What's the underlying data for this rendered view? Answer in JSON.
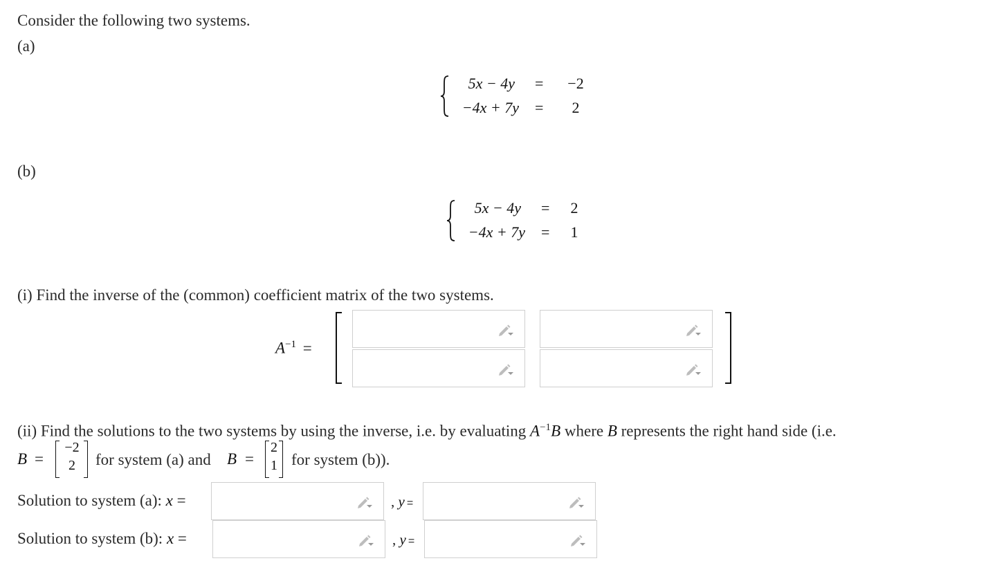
{
  "intro": "Consider the following two systems.",
  "system_a": {
    "label": "(a)",
    "rows": [
      {
        "lhs": "5x − 4y",
        "eq": "=",
        "rhs": "−2"
      },
      {
        "lhs": "−4x + 7y",
        "eq": "=",
        "rhs": "2"
      }
    ]
  },
  "system_b": {
    "label": "(b)",
    "rows": [
      {
        "lhs": "5x − 4y",
        "eq": "=",
        "rhs": "2"
      },
      {
        "lhs": "−4x + 7y",
        "eq": "=",
        "rhs": "1"
      }
    ]
  },
  "part_i": {
    "prompt": "(i) Find the inverse of the (common) coefficient matrix of the two systems.",
    "lhs_label": "A",
    "lhs_sup": "−1",
    "lhs_eq": "=",
    "cells": [
      {
        "value": "",
        "placeholder": ""
      },
      {
        "value": "",
        "placeholder": ""
      },
      {
        "value": "",
        "placeholder": ""
      },
      {
        "value": "",
        "placeholder": ""
      }
    ]
  },
  "part_ii": {
    "prompt_start": "(ii) Find the solutions to the two systems by using the inverse, i.e. by evaluating ",
    "prompt_A": "A",
    "prompt_sup": "−1",
    "prompt_B": "B",
    "prompt_mid": " where ",
    "prompt_B2": "B",
    "prompt_end": " represents the right hand side (i.e.",
    "b_label": "B",
    "eq": "=",
    "b_a": [
      "−2",
      "2"
    ],
    "for_a": "for system (a) and",
    "b_b": [
      "2",
      "1"
    ],
    "for_b": "for system (b))."
  },
  "solutions": [
    {
      "label": "Solution to system (a): ",
      "x_var": "x",
      "eq": "=",
      "sep": ", ",
      "y_var": "y",
      "y_eq": "=",
      "x_value": "",
      "y_value": ""
    },
    {
      "label": "Solution to system (b): ",
      "x_var": "x",
      "eq": "=",
      "sep": ", ",
      "y_var": "y",
      "y_eq": "=",
      "x_value": "",
      "y_value": ""
    }
  ],
  "icons": {
    "input_tool": "pencil-dropdown-icon"
  },
  "colors": {
    "field_border": "#cfcfcf",
    "icon_gray": "#bbbbbb",
    "text": "#2a2a2a"
  }
}
